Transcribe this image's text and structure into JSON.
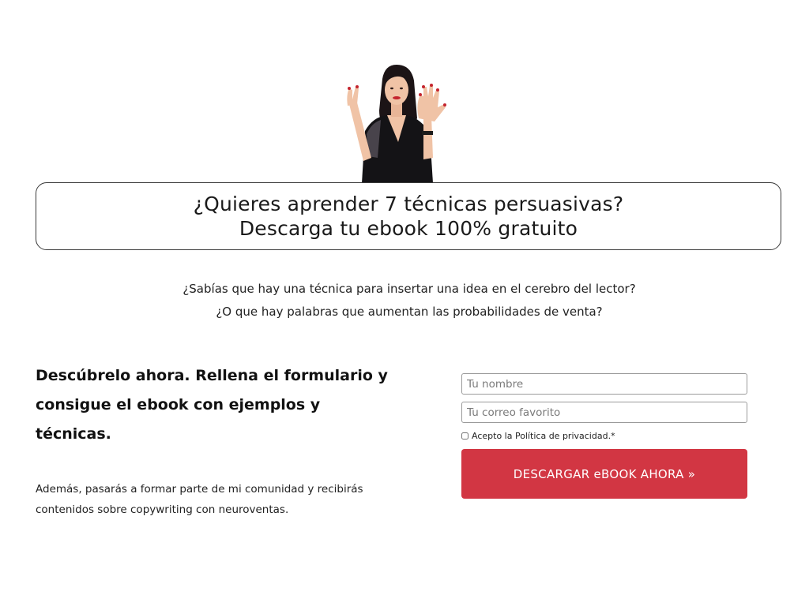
{
  "hero": {
    "image_name": "woman-showing-seven-fingers",
    "colors": {
      "hair": "#1c1416",
      "skin": "#f0c3a6",
      "dress": "#141316",
      "nails": "#c4242e"
    }
  },
  "headline": {
    "line1": "¿Quieres aprender 7 técnicas persuasivas?",
    "line2": "Descarga tu ebook 100% gratuito"
  },
  "intro": {
    "line1": "¿Sabías que hay una técnica para insertar una idea en el cerebro del lector?",
    "line2": "¿O que hay palabras que aumentan las probabilidades de venta?"
  },
  "cta": {
    "heading_line1": "Descúbrelo ahora. Rellena el formulario y",
    "heading_line2": "consigue el ebook con ejemplos y",
    "heading_line3": "técnicas.",
    "sub_line1": "Además, pasarás a formar parte de mi comunidad y recibirás",
    "sub_line2": "contenidos sobre copywriting con neuroventas."
  },
  "form": {
    "name_placeholder": "Tu nombre",
    "email_placeholder": "Tu correo favorito",
    "privacy_label": "Acepto la Política de privacidad.*",
    "submit_label": "DESCARGAR eBOOK AHORA »",
    "button_color": "#d23643"
  }
}
